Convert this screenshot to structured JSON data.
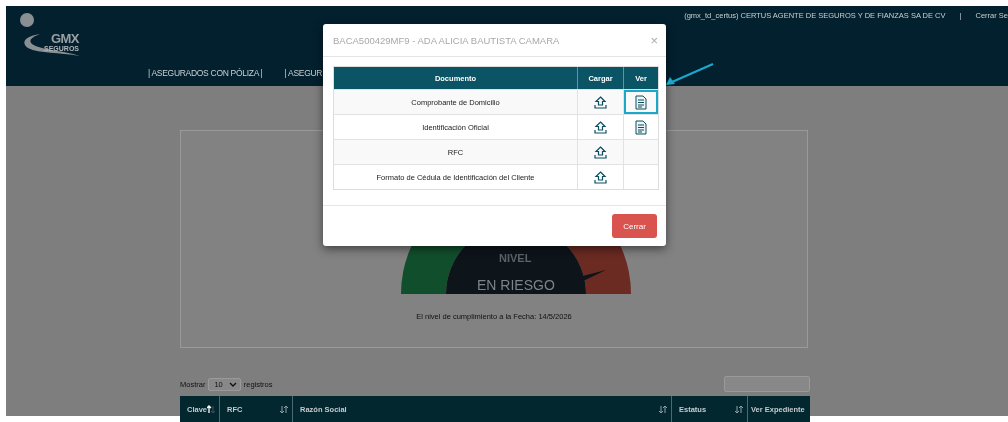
{
  "header": {
    "logo": {
      "brand": "GMX",
      "tagline": "SEGUROS"
    },
    "user_info": "(gmx_td_certus) CERTUS AGENTE DE SEGUROS Y DE FIANZAS SA DE CV",
    "separator": "|",
    "logout": "Cerrar Se",
    "nav_items": [
      "| ASEGURADOS CON PÓLIZA |",
      "| ASEGUR"
    ]
  },
  "card": {
    "gauge": {
      "label": "NIVEL",
      "status": "EN RIESGO"
    },
    "compliance_text": "El nivel de cumplimiento a la Fecha: 14/5/2026"
  },
  "table_controls": {
    "show_label": "Mostrar",
    "page_size": "10",
    "records_label": "registros"
  },
  "table": {
    "columns": [
      {
        "label": "Clave",
        "sortable": true,
        "sorted": true
      },
      {
        "label": "RFC",
        "sortable": true,
        "sorted": false
      },
      {
        "label": "Razón Social",
        "sortable": true,
        "sorted": false
      },
      {
        "label": "Estatus",
        "sortable": true,
        "sorted": false
      },
      {
        "label": "Ver Expediente",
        "sortable": false
      }
    ]
  },
  "modal": {
    "title": "BACA500429MF9 - ADA ALICIA BAUTISTA CAMARA",
    "close": "×",
    "columns": [
      "Documento",
      "Cargar",
      "Ver"
    ],
    "documents": [
      {
        "name": "Comprobante de Domicilio",
        "viewable": true,
        "highlighted": true
      },
      {
        "name": "Identificación Oficial",
        "viewable": true,
        "highlighted": false
      },
      {
        "name": "RFC",
        "viewable": false,
        "highlighted": false
      },
      {
        "name": "Formato de Cédula de Identificación del Cliente",
        "viewable": false,
        "highlighted": false
      }
    ],
    "close_button": "Cerrar"
  },
  "annotation": {
    "kind": "arrow"
  }
}
